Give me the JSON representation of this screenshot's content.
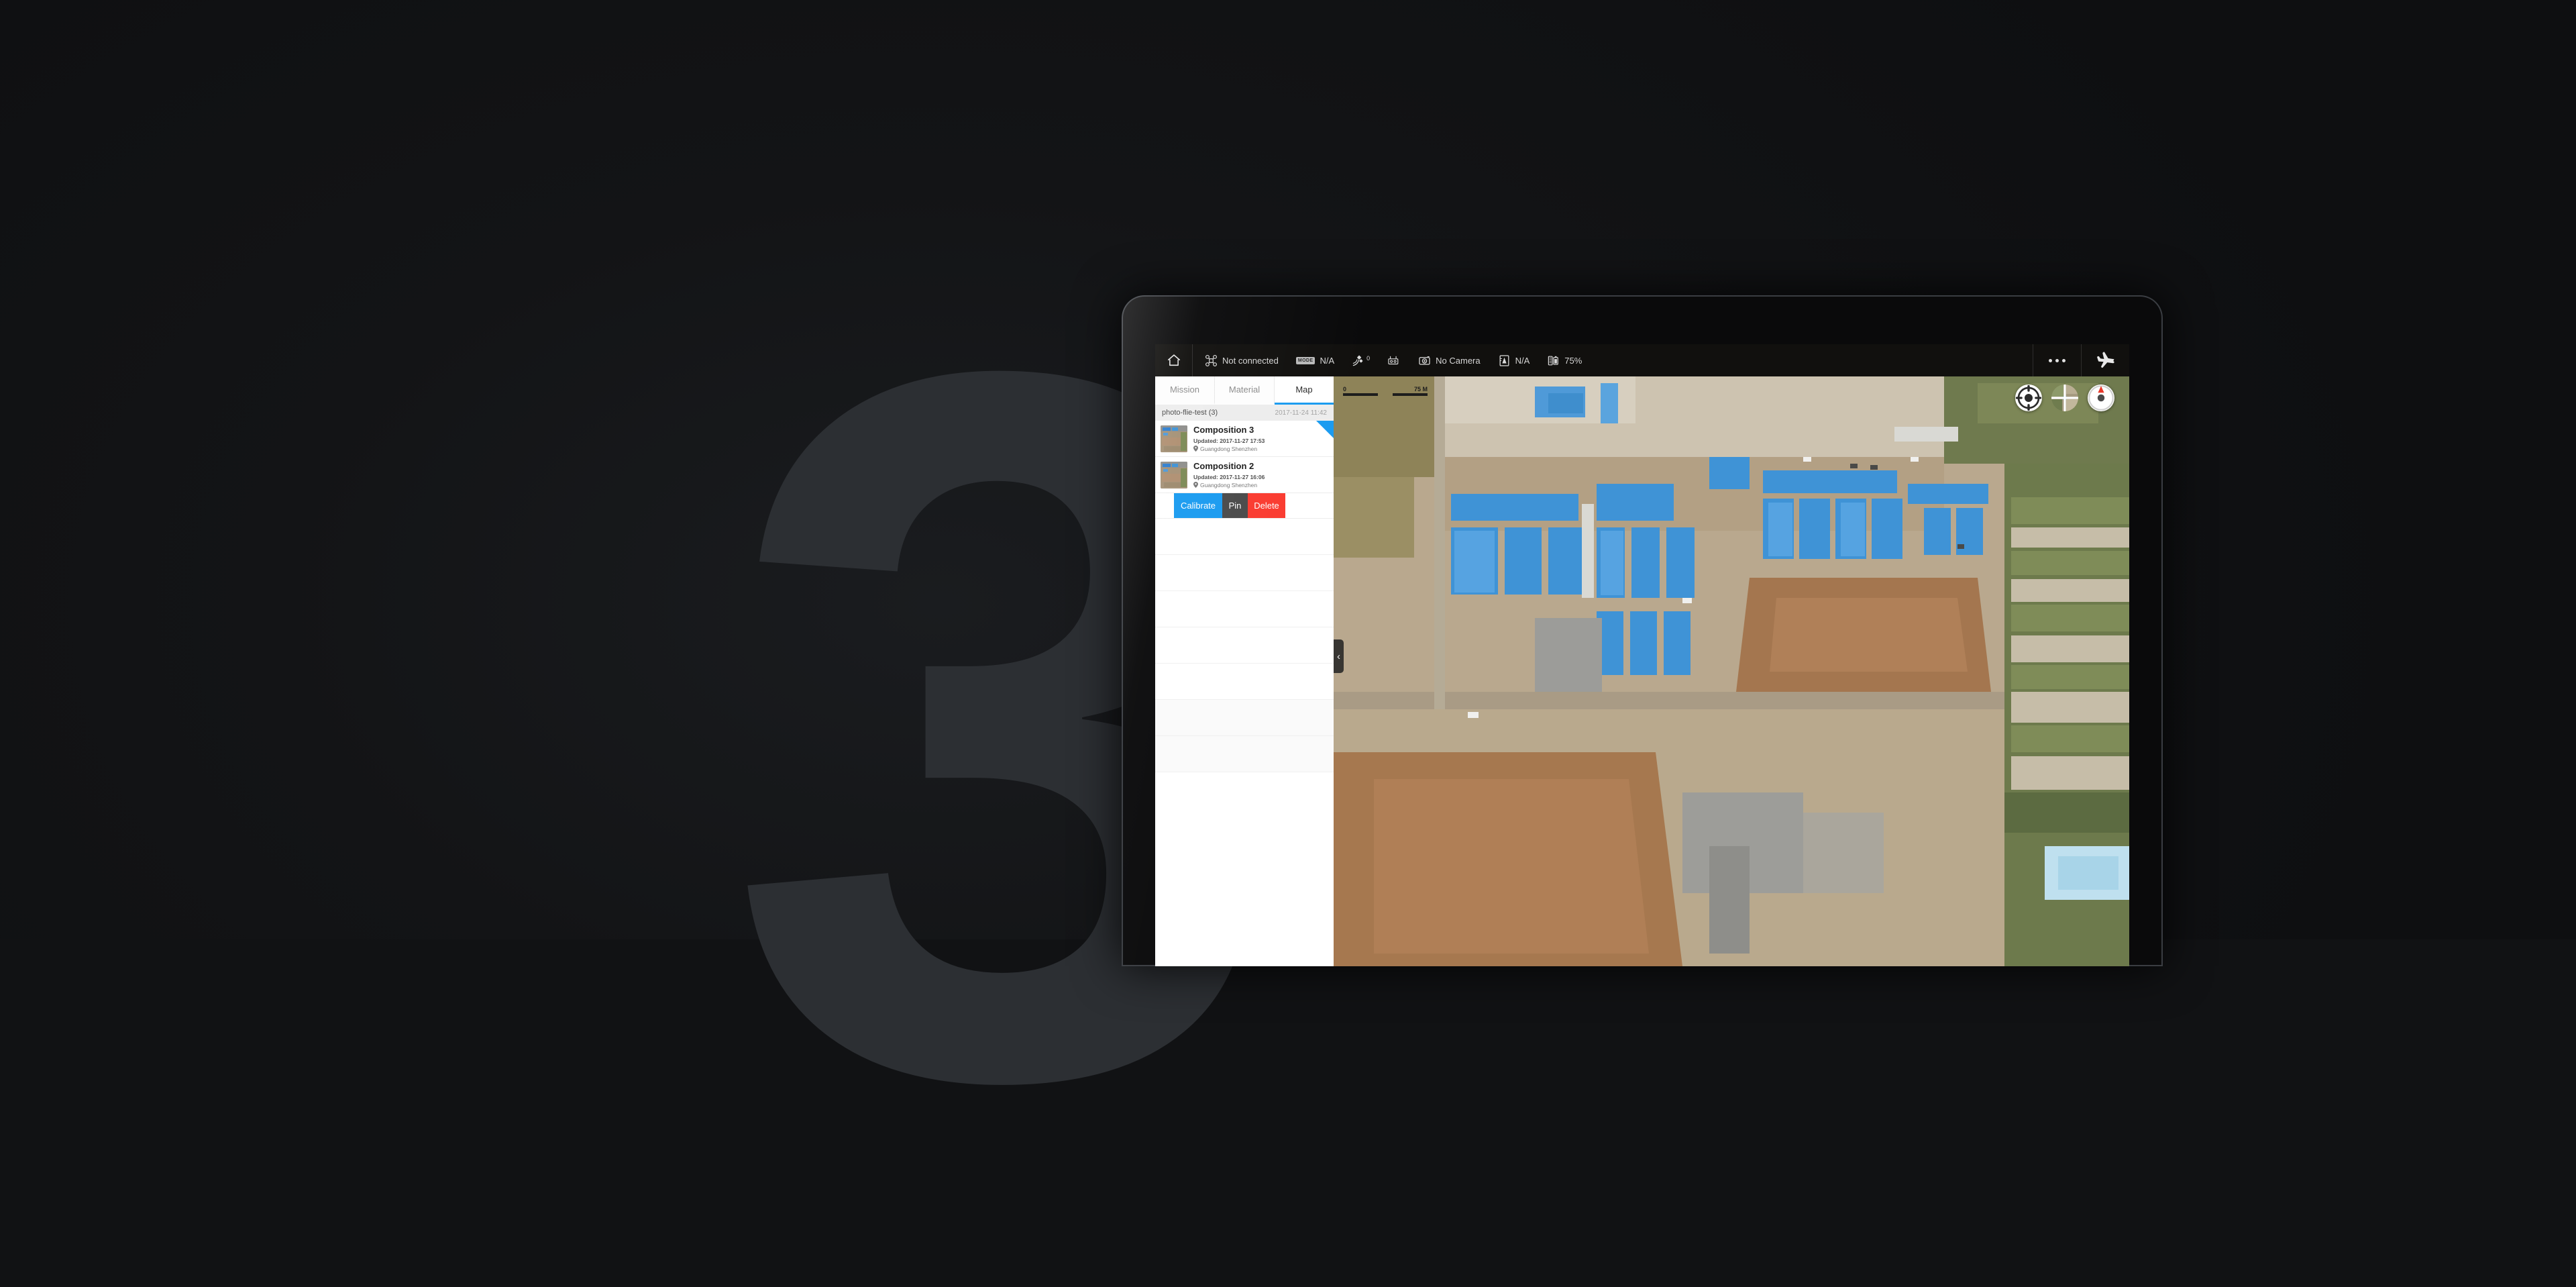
{
  "watermark": {
    "text": "3"
  },
  "toolbar": {
    "home_icon": "home-icon",
    "items": [
      {
        "icon": "drone-icon",
        "label": "Not connected"
      },
      {
        "icon": "mode-badge-icon",
        "label": "N/A",
        "badge": "MODE"
      },
      {
        "icon": "satellite-icon",
        "label": "",
        "superscript": "0"
      },
      {
        "icon": "remote-controller-icon",
        "label": ""
      },
      {
        "icon": "camera-icon",
        "label": "No Camera"
      },
      {
        "icon": "altitude-icon",
        "label": "N/A"
      },
      {
        "icon": "battery-icon",
        "label": "75%"
      }
    ],
    "more_label": "more-options",
    "fly_label": "fly-mode"
  },
  "panel": {
    "tabs": [
      {
        "label": "Mission",
        "active": false
      },
      {
        "label": "Material",
        "active": false
      },
      {
        "label": "Map",
        "active": true
      }
    ],
    "list_header": {
      "title": "photo-flie-test (3)",
      "date": "2017-11-24 11:42"
    },
    "rows": [
      {
        "title": "Composition 3",
        "updated": "Updated: 2017-11-27 17:53",
        "location": "Guangdong Shenzhen",
        "flagged": true
      },
      {
        "title": "Composition 2",
        "updated": "Updated: 2017-11-27 16:06",
        "location": "Guangdong Shenzhen",
        "flagged": false
      }
    ],
    "swipe_actions": [
      {
        "label": "Calibrate",
        "color": "#1a9bf0"
      },
      {
        "label": "Pin",
        "color": "#4a4a4a"
      },
      {
        "label": "Delete",
        "color": "#fa3b30"
      }
    ],
    "collapse_icon": "‹"
  },
  "map": {
    "scale": {
      "min": "0",
      "max": "75 M"
    },
    "controls": [
      {
        "name": "locate-button",
        "icon": "crosshair-icon"
      },
      {
        "name": "layers-button",
        "icon": "map-layers-icon"
      },
      {
        "name": "compass-button",
        "icon": "compass-icon"
      }
    ]
  },
  "colors": {
    "accent": "#1a9bf0",
    "danger": "#fa3b30",
    "neutral": "#4a4a4a"
  }
}
